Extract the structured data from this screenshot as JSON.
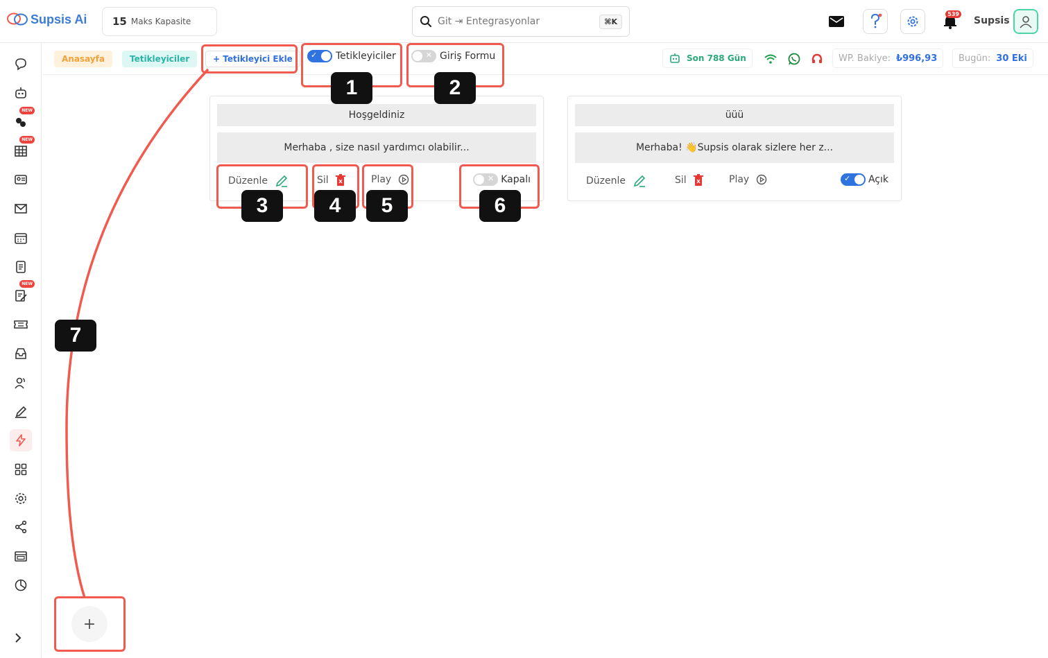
{
  "header": {
    "brand": "Supsis Ai",
    "capacity_value": "15",
    "capacity_label": "Maks Kapasite",
    "search_text": "Git ⇥ Entegrasyonlar",
    "search_shortcut": "⌘K",
    "notification_count": "539",
    "user_name": "Supsis"
  },
  "breadcrumb": {
    "home": "Anasayfa",
    "current": "Tetikleyiciler",
    "add_button": "+ Tetikleyici Ekle"
  },
  "tabs": {
    "triggers_label": "Tetikleyiciler",
    "triggers_on": true,
    "login_form_label": "Giriş Formu",
    "login_form_on": false
  },
  "status": {
    "days": "Son 788 Gün",
    "wp_balance_label": "WP. Bakiye:",
    "wp_balance_value": "₺996,93",
    "today_label": "Bugün:",
    "today_value": "30 Eki"
  },
  "cards": [
    {
      "title": "Hoşgeldiniz",
      "message": "Merhaba , size nasıl yardımcı olabilir...",
      "edit_label": "Düzenle",
      "delete_label": "Sil",
      "play_label": "Play",
      "toggle_label": "Kapalı",
      "enabled": false
    },
    {
      "title": "üüü",
      "message": "Merhaba! 👋Supsis olarak sizlere her z...",
      "edit_label": "Düzenle",
      "delete_label": "Sil",
      "play_label": "Play",
      "toggle_label": "Açık",
      "enabled": true
    }
  ],
  "sidebar": {
    "new_badge": "NEW",
    "items": [
      "chat-icon",
      "bot-icon",
      "team-new-icon",
      "table-new-icon",
      "contact-card-icon",
      "mail-icon",
      "calendar-icon",
      "notes-icon",
      "edit-doc-new-icon",
      "ticket-icon",
      "inbox-icon",
      "users-icon",
      "pen-icon",
      "lightning-icon",
      "grid-icon",
      "gear-icon",
      "share-icon",
      "browser-icon",
      "pie-chart-icon"
    ],
    "active_item": "lightning-icon"
  },
  "annotations": [
    "1",
    "2",
    "3",
    "4",
    "5",
    "6",
    "7"
  ],
  "colors": {
    "highlight": "#f05a4f",
    "toggle_on": "#2f73e0",
    "accent_blue": "#2f6fe0"
  }
}
